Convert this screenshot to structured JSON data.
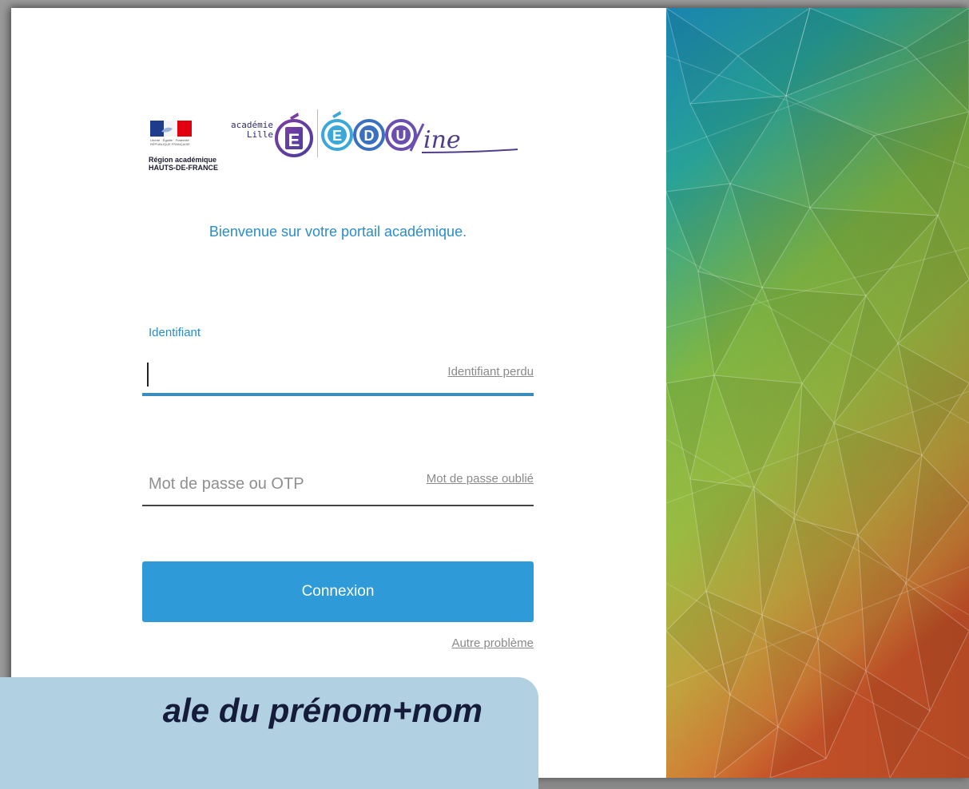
{
  "logo": {
    "flag_small_text": "Liberté · Égalité · Fraternité RÉPUBLIQUE FRANÇAISE",
    "region_line1": "Région académique",
    "region_line2": "HAUTS-DE-FRANCE",
    "academie_line1": "académie",
    "academie_line2": "Lille",
    "edu_suffix": "ine"
  },
  "welcome": "Bienvenue sur votre portail académique.",
  "login": {
    "id_label": "Identifiant",
    "id_value": "",
    "id_lost_link": "Identifiant perdu",
    "password_placeholder": "Mot de passe ou OTP",
    "password_forgot_link": "Mot de passe oublié",
    "submit_label": "Connexion",
    "other_problem_link": "Autre problème"
  },
  "callout": {
    "text": "ale du prénom+nom"
  },
  "colors": {
    "accent": "#2a8dc8",
    "button": "#2e9bd8",
    "callout_bg": "#b1d0e2"
  }
}
